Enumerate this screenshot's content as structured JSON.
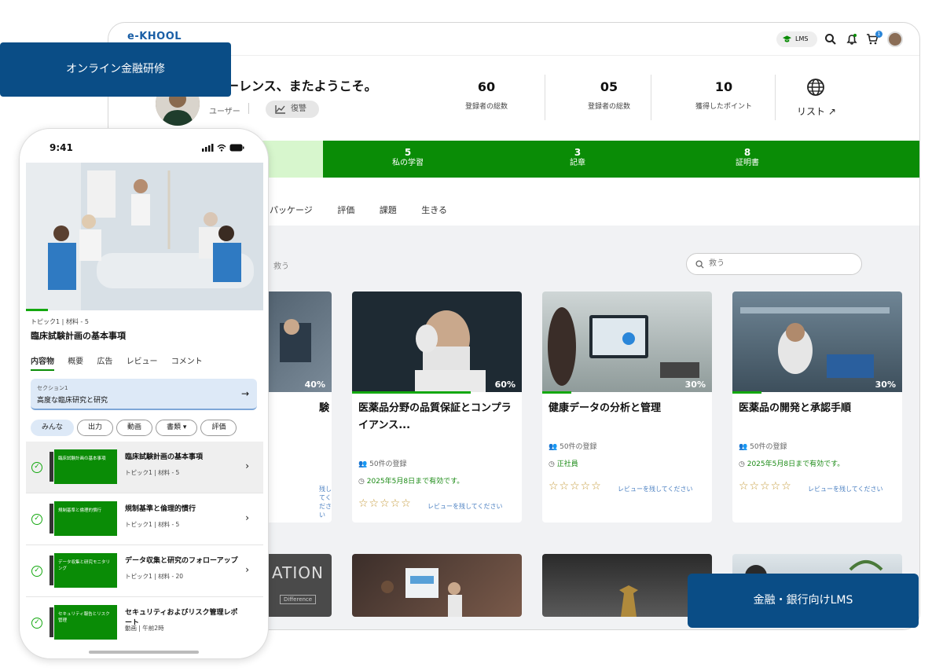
{
  "desktop": {
    "logo": "e-KHOOL",
    "lms_pill": "LMS",
    "cart_badge": "1",
    "welcome": "ーレンス、またようこそ。",
    "user_role": "ユーザー",
    "review_pill": "復讐",
    "stats": [
      {
        "value": "60",
        "label": "登録者の総数"
      },
      {
        "value": "05",
        "label": "登録者の総数"
      },
      {
        "value": "10",
        "label": "獲得したポイント"
      }
    ],
    "list_link": "リスト ↗",
    "greenbar": [
      {
        "value": "5",
        "label": "私の学習"
      },
      {
        "value": "3",
        "label": "記章"
      },
      {
        "value": "8",
        "label": "証明書"
      }
    ],
    "tabs": [
      "パッケージ",
      "評価",
      "課題",
      "生きる"
    ],
    "save_text": "救う",
    "search_placeholder": "救う",
    "cards": [
      {
        "title": "験",
        "progress": "40%",
        "review_link": "残してください"
      },
      {
        "title": "医薬品分野の品質保証とコンプライアンス...",
        "progress": "60%",
        "enrolled": "50件の登録",
        "validity": "2025年5月8日まで有効です。",
        "review_link": "レビューを残してください"
      },
      {
        "title": "健康データの分析と管理",
        "progress": "30%",
        "enrolled": "50件の登録",
        "validity": "正社員",
        "review_link": "レビューを残してください"
      },
      {
        "title": "医薬品の開発と承認手順",
        "progress": "30%",
        "enrolled": "50件の登録",
        "validity": "2025年5月8日まで有効です。",
        "review_link": "レビューを残してください"
      }
    ],
    "second_row_text": "ATION",
    "second_row_sub": "Difference"
  },
  "callouts": {
    "top_left": "オンライン金融研修",
    "bottom_right": "金融・銀行向けLMS"
  },
  "phone": {
    "time": "9:41",
    "crumb": "トピック1 | 材料 - 5",
    "title": "臨床試験計画の基本事項",
    "tabs": [
      "内容物",
      "概要",
      "広告",
      "レビュー",
      "コメント"
    ],
    "section_kicker": "セクション1",
    "section_title": "高度な臨床研究と研究",
    "chips": [
      "みんな",
      "出力",
      "動画",
      "書類 ▾",
      "評価"
    ],
    "lessons": [
      {
        "thumb": "臨床試験計画の基本事項",
        "title": "臨床試験計画の基本事項",
        "meta": "トピック1 | 材料 - 5"
      },
      {
        "thumb": "規制基準と倫理的慣行",
        "title": "規制基準と倫理的慣行",
        "meta": "トピック1 | 材料 - 5"
      },
      {
        "thumb": "データ収集と研究モニタリング",
        "title": "データ収集と研究のフォローアップ",
        "meta": "トピック1 | 材料 - 20"
      },
      {
        "thumb": "セキュリティ報告とリスク管理",
        "title": "セキュリティおよびリスク管理レポート",
        "meta": "動画 | 午前2時"
      }
    ]
  }
}
